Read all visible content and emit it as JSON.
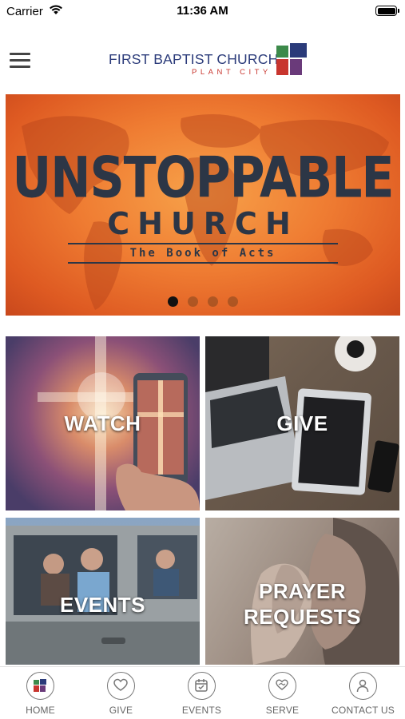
{
  "status_bar": {
    "carrier": "Carrier",
    "time": "11:36 AM"
  },
  "header": {
    "logo_title": "FIRST BAPTIST CHURCH",
    "logo_subtitle": "PLANT CITY"
  },
  "hero": {
    "title": "UNSTOPPABLE",
    "subtitle": "CHURCH",
    "caption": "The Book of Acts",
    "slide_count": 4,
    "active_slide": 1
  },
  "tiles": {
    "watch": "WATCH",
    "give": "GIVE",
    "events": "EVENTS",
    "prayer_line1": "PRAYER",
    "prayer_line2": "REQUESTS"
  },
  "bottom_nav": {
    "items": [
      {
        "label": "HOME",
        "icon": "church-logo-icon"
      },
      {
        "label": "GIVE",
        "icon": "heart-icon"
      },
      {
        "label": "EVENTS",
        "icon": "calendar-icon"
      },
      {
        "label": "SERVE",
        "icon": "handshake-heart-icon"
      },
      {
        "label": "CONTACT US",
        "icon": "person-icon"
      }
    ]
  },
  "colors": {
    "logo_navy": "#2b3b7a",
    "logo_red": "#c8352e",
    "hero_orange": "#ef7c32",
    "hero_text": "#2c3646"
  }
}
